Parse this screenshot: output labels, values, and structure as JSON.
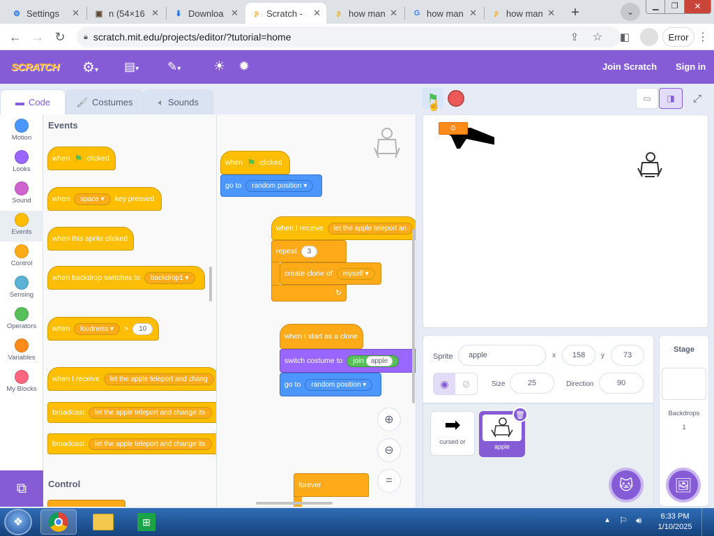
{
  "browser": {
    "tabs": [
      {
        "title": "Settings",
        "fav": "⚙",
        "fav_color": "#1a73e8"
      },
      {
        "title": "n (54×16",
        "fav": "▣",
        "fav_color": "#5f4b32"
      },
      {
        "title": "Downloa",
        "fav": "⬇",
        "fav_color": "#1a73e8"
      },
      {
        "title": "Scratch -",
        "fav": "ʂ",
        "fav_color": "#f9a825"
      },
      {
        "title": "how man",
        "fav": "ʂ",
        "fav_color": "#f9a825"
      },
      {
        "title": "how man",
        "fav": "G",
        "fav_color": "#4285f4"
      },
      {
        "title": "how man",
        "fav": "ʂ",
        "fav_color": "#f9a825"
      }
    ],
    "url": "scratch.mit.edu/projects/editor/?tutorial=home",
    "error_label": "Error"
  },
  "menubar": {
    "logo": "SCRATCH",
    "join": "Join Scratch",
    "signin": "Sign in"
  },
  "editor_tabs": {
    "code": "Code",
    "costumes": "Costumes",
    "sounds": "Sounds"
  },
  "categories": [
    {
      "label": "Motion",
      "color": "#4c97ff"
    },
    {
      "label": "Looks",
      "color": "#9966ff"
    },
    {
      "label": "Sound",
      "color": "#cf63cf"
    },
    {
      "label": "Events",
      "color": "#ffbf00"
    },
    {
      "label": "Control",
      "color": "#ffab19"
    },
    {
      "label": "Sensing",
      "color": "#5cb1d6"
    },
    {
      "label": "Operators",
      "color": "#59c059"
    },
    {
      "label": "Variables",
      "color": "#ff8c1a"
    },
    {
      "label": "My Blocks",
      "color": "#ff6680"
    }
  ],
  "palette": {
    "events_heading": "Events",
    "control_heading": "Control",
    "when": "when",
    "clicked": "clicked",
    "space": "space",
    "key_pressed": "key pressed",
    "when_sprite_clicked": "when this sprite clicked",
    "when_backdrop": "when backdrop switches to",
    "backdrop1": "backdrop1",
    "loudness": "loudness",
    "gt": ">",
    "ten": "10",
    "when_i_receive": "when I receive",
    "message": "let the apple teleport and chang",
    "broadcast": "broadcast",
    "broadcast_msg": "let the apple teleport and change its"
  },
  "scripts": {
    "when": "when",
    "clicked": "clicked",
    "go_to": "go to",
    "random_position": "random position",
    "when_i_receive": "when I receive",
    "receive_msg": "let the apple teleport an",
    "repeat": "repeat",
    "three": "3",
    "create_clone": "create clone of",
    "myself": "myself",
    "clone_start": "when I start as a clone",
    "switch_costume": "switch costume to",
    "join": "join",
    "apple": "apple",
    "forever": "forever"
  },
  "stage": {
    "counter": "0"
  },
  "sprite_info": {
    "sprite_label": "Sprite",
    "sprite_name": "apple",
    "x_label": "x",
    "x": "158",
    "y_label": "y",
    "y": "73",
    "size_label": "Size",
    "size": "25",
    "direction_label": "Direction",
    "direction": "90"
  },
  "sprites": [
    {
      "name": "cursed or"
    },
    {
      "name": "apple"
    }
  ],
  "stage_panel": {
    "title": "Stage",
    "backdrops_label": "Backdrops",
    "backdrops_count": "1"
  },
  "taskbar": {
    "time": "6:33 PM",
    "date": "1/10/2025"
  }
}
